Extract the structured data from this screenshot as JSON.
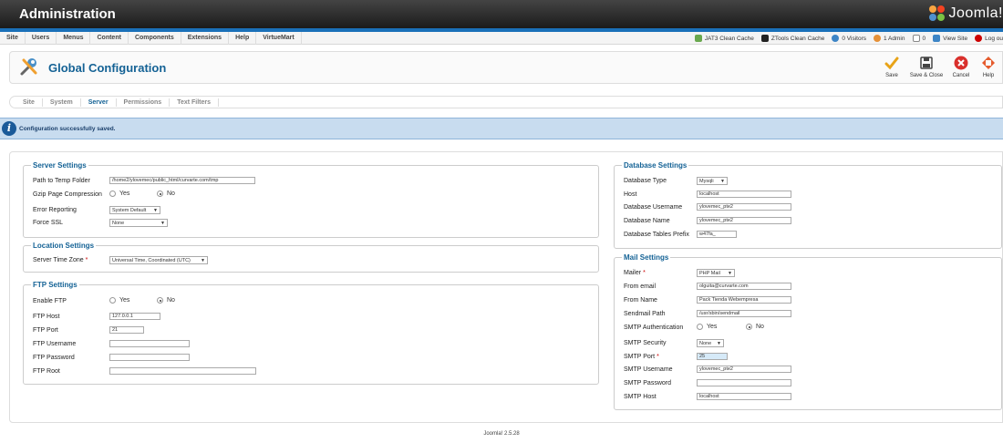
{
  "header": {
    "title": "Administration",
    "logo_text": "Joomla!"
  },
  "menu": {
    "items": [
      "Site",
      "Users",
      "Menus",
      "Content",
      "Components",
      "Extensions",
      "Help",
      "VirtueMart"
    ]
  },
  "status": {
    "jat3": "JAT3 Clean Cache",
    "ztools": "ZTools Clean Cache",
    "visitors": "0 Visitors",
    "admin": "1 Admin",
    "messages": "0",
    "view_site": "View Site",
    "logout": "Log ou"
  },
  "toolbar": {
    "title": "Global Configuration",
    "save": "Save",
    "save_close": "Save & Close",
    "cancel": "Cancel",
    "help": "Help"
  },
  "tabs": [
    "Site",
    "System",
    "Server",
    "Permissions",
    "Text Filters"
  ],
  "active_tab": "Server",
  "message": "Configuration successfully saved.",
  "server": {
    "legend": "Server Settings",
    "temp_label": "Path to Temp Folder",
    "temp_value": "/home2/ylovemec/public_html/curvarte.com/tmp",
    "gzip_label": "Gzip Page Compression",
    "gzip_yes": "Yes",
    "gzip_no": "No",
    "error_label": "Error Reporting",
    "error_value": "System Default",
    "ssl_label": "Force SSL",
    "ssl_value": "None"
  },
  "location": {
    "legend": "Location Settings",
    "tz_label": "Server Time Zone",
    "tz_value": "Universal Time, Coordinated (UTC)"
  },
  "ftp": {
    "legend": "FTP Settings",
    "enable_label": "Enable FTP",
    "enable_yes": "Yes",
    "enable_no": "No",
    "host_label": "FTP Host",
    "host_value": "127.0.0.1",
    "port_label": "FTP Port",
    "port_value": "21",
    "user_label": "FTP Username",
    "user_value": "",
    "pass_label": "FTP Password",
    "pass_value": "",
    "root_label": "FTP Root",
    "root_value": ""
  },
  "database": {
    "legend": "Database Settings",
    "type_label": "Database Type",
    "type_value": "Mysqli",
    "host_label": "Host",
    "host_value": "localhost",
    "user_label": "Database Username",
    "user_value": "ylovemec_pte2",
    "name_label": "Database Name",
    "name_value": "ylovemec_pte2",
    "prefix_label": "Database Tables Prefix",
    "prefix_value": "w47fa_"
  },
  "mail": {
    "legend": "Mail Settings",
    "mailer_label": "Mailer",
    "mailer_value": "PHP Mail",
    "from_email_label": "From email",
    "from_email_value": "olguita@curvarte.com",
    "from_name_label": "From Name",
    "from_name_value": "Pack Tienda Webempresa",
    "sendmail_label": "Sendmail Path",
    "sendmail_value": "/usr/sbin/sendmail",
    "smtp_auth_label": "SMTP Authentication",
    "smtp_auth_yes": "Yes",
    "smtp_auth_no": "No",
    "smtp_sec_label": "SMTP Security",
    "smtp_sec_value": "None",
    "smtp_port_label": "SMTP Port",
    "smtp_port_value": "25",
    "smtp_user_label": "SMTP Username",
    "smtp_user_value": "ylovemec_pte2",
    "smtp_pass_label": "SMTP Password",
    "smtp_pass_value": "",
    "smtp_host_label": "SMTP Host",
    "smtp_host_value": "localhost"
  },
  "footer": "Joomla! 2.5.28"
}
